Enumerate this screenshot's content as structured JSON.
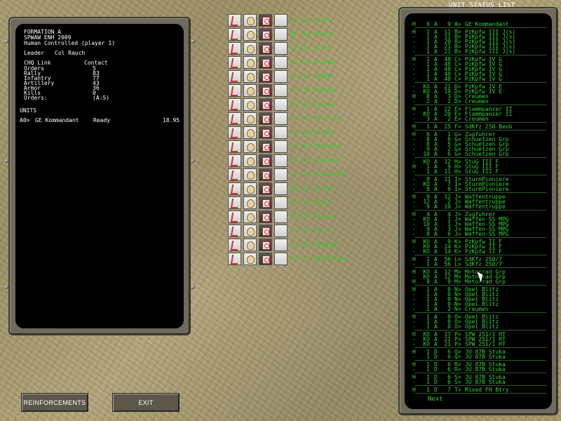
{
  "formation": {
    "title": "FORMATION A",
    "scenario": "SPWAW ENH 2009",
    "control": "Human Controlled (player 1)",
    "leader_label": "Leader",
    "leader_value": "Col Rauch",
    "stats_header": [
      "CHQ Link",
      "Contact"
    ],
    "stats": [
      {
        "label": "Orders",
        "value": "5"
      },
      {
        "label": "Rally",
        "value": "83"
      },
      {
        "label": "Infantry",
        "value": "77"
      },
      {
        "label": "Artillery",
        "value": "43"
      },
      {
        "label": "Armor",
        "value": "36"
      },
      {
        "label": "Kills",
        "value": "0"
      },
      {
        "label": "Orders:",
        "value": "(A:5)"
      }
    ],
    "units_label": "UNITS",
    "units": [
      {
        "id": "A0>",
        "name": "GE Kommandant",
        "status": "Ready",
        "value": "18.95"
      }
    ]
  },
  "formation_leaders": [
    "A> Col Rauch",
    "B> 1Lt Brandt",
    "C> 1Lt Wirth",
    "D> 1Lt Stiegel",
    "E> 1Lt Vebber",
    "F> 1Lt Steiner",
    "G> 1Lt Krause",
    "H> 2Lt Heidrich",
    "I> Sgt Krogel",
    "J> 2Lt Albrecht",
    "K> 2Lt Schirmer",
    "L> 1Lt Schmeltzer",
    "M> 1Lt Teiner",
    "N> 1Lt Meyer",
    "O> 1Lt Brunner",
    "P> 1Lt Wirth",
    "Q> 1Lt Baumann",
    "R> 1Lt Rittenhaus"
  ],
  "unit_status": {
    "title": "UNIT STATUS LIST",
    "groups": [
      [
        [
          "H",
          "6",
          "A",
          "9",
          "A>",
          "GE Kommandant"
        ]
      ],
      [
        [
          "H",
          "1",
          "A",
          "11",
          "B>",
          "PzKpfw III J(s)"
        ],
        [
          "-",
          "1",
          "A",
          "11",
          "B>",
          "PzKpfw III J(s)"
        ],
        [
          "-",
          "1",
          "A",
          "20",
          "B>",
          "PzKpfw III J(s)"
        ],
        [
          "-",
          "1",
          "A",
          "21",
          "B>",
          "PzKpfw III J(s)"
        ],
        [
          "-",
          "1",
          "A",
          "21",
          "B>",
          "PzKpfw III J(s)"
        ]
      ],
      [
        [
          "H",
          "1",
          "A",
          "48",
          "C>",
          "PzKpfw IV G"
        ],
        [
          "-",
          "1",
          "A",
          "48",
          "C>",
          "PzKpfw IV G"
        ],
        [
          "-",
          "1",
          "A",
          "48",
          "C>",
          "PzKpfw IV G"
        ],
        [
          "-",
          "1",
          "A",
          "48",
          "C>",
          "PzKpfw IV G"
        ],
        [
          "-",
          "1",
          "A",
          "48",
          "C>",
          "PzKpfw IV G"
        ]
      ],
      [
        [
          "-",
          "KO",
          "A",
          "21",
          "D>",
          "PzKpfw IV E"
        ],
        [
          "-",
          "KO",
          "A",
          "19",
          "D>",
          "PzKpfw IV E"
        ],
        [
          "H",
          "8",
          "A",
          "3",
          "D>",
          "Creumen"
        ],
        [
          "-",
          "2",
          "A",
          "2",
          "D>",
          "Creumen"
        ]
      ],
      [
        [
          "H",
          "1",
          "A",
          "22",
          "E>",
          "Flammpanzer II"
        ],
        [
          "-",
          "KO",
          "A",
          "20",
          "E>",
          "Flammpanzer II"
        ],
        [
          "-",
          "3",
          "A",
          "2",
          "E>",
          "Creumen"
        ]
      ],
      [
        [
          "H",
          "1",
          "A",
          "25",
          "F>",
          "SdKfz 250 Beob"
        ]
      ],
      [
        [
          "H",
          "6",
          "A",
          "1",
          "G>",
          "Zugfuhrer"
        ],
        [
          "-",
          "8",
          "A",
          "6",
          "G>",
          "Schuetzen Grp"
        ],
        [
          "-",
          "8",
          "A",
          "5",
          "G>",
          "Schuetzen Grp"
        ],
        [
          "-",
          "9",
          "A",
          "2",
          "G>",
          "Schuetzen Grp"
        ],
        [
          "-",
          "10",
          "A",
          "6",
          "G>",
          "Schuetzen Grp"
        ]
      ],
      [
        [
          "-",
          "KO",
          "A",
          "12",
          "H>",
          "StuG III F"
        ],
        [
          "H",
          "1",
          "A",
          "9",
          "H>",
          "StuG III F"
        ],
        [
          "-",
          "1",
          "A",
          "11",
          "H>",
          "StuG III F"
        ]
      ],
      [
        [
          "-",
          "8",
          "A",
          "11",
          "I>",
          "SturmPioniere"
        ],
        [
          "-",
          "KO",
          "A",
          "7",
          "I>",
          "SturmPioniere"
        ],
        [
          "-",
          "8",
          "A",
          "6",
          "I>",
          "SturmPioniere"
        ]
      ],
      [
        [
          "H",
          "9",
          "A",
          "12",
          "J>",
          "Waffentruppe"
        ],
        [
          "-",
          "12",
          "A",
          "2",
          "J>",
          "Waffentruppe"
        ],
        [
          "-",
          "9",
          "A",
          "10",
          "J>",
          "Waffentruppe"
        ]
      ],
      [
        [
          "H",
          "4",
          "A",
          "4",
          "J>",
          "Zugfuhrer"
        ],
        [
          "-",
          "KO",
          "A",
          "1",
          "J>",
          "Waffen-SS MPG"
        ],
        [
          "-",
          "10",
          "A",
          "1",
          "J>",
          "Waffen-SS MPG"
        ],
        [
          "-",
          "9",
          "A",
          "3",
          "J>",
          "Waffen-SS MPG"
        ],
        [
          "-",
          "8",
          "A",
          "6",
          "J>",
          "Waffen-SS MPG"
        ]
      ],
      [
        [
          "H",
          "KO",
          "A",
          "9",
          "K>",
          "PzKpfw II F"
        ],
        [
          "-",
          "KO",
          "A",
          "14",
          "K>",
          "PzKpfw II F"
        ],
        [
          "-",
          "KO",
          "A",
          "14",
          "K>",
          "PzKpfw II F"
        ]
      ],
      [
        [
          "H",
          "1",
          "A",
          "56",
          "L>",
          "SdKfz 250/7"
        ],
        [
          "-",
          "1",
          "A",
          "56",
          "L>",
          "SdKfz 250/7"
        ]
      ],
      [
        [
          "H",
          "KO",
          "A",
          "12",
          "M>",
          "Motorrad Grp"
        ],
        [
          "-",
          "KO",
          "A",
          "12",
          "M>",
          "Motorrad Grp"
        ],
        [
          "H",
          "8",
          "A",
          "9",
          "M>",
          "Motorrad Grp"
        ]
      ],
      [
        [
          "H",
          "1",
          "A",
          "0",
          "N>",
          "Opel Blitz"
        ],
        [
          "-",
          "1",
          "A",
          "0",
          "N>",
          "Opel Blitz"
        ],
        [
          "-",
          "1",
          "A",
          "0",
          "N>",
          "Opel Blitz"
        ],
        [
          "-",
          "1",
          "A",
          "0",
          "N>",
          "Opel Blitz"
        ],
        [
          "-",
          "1",
          "A",
          "2",
          "N>",
          "Creumen"
        ]
      ],
      [
        [
          "H",
          "1",
          "A",
          "0",
          "O>",
          "Opel Blitz"
        ],
        [
          "-",
          "1",
          "A",
          "0",
          "O>",
          "Opel Blitz"
        ],
        [
          "-",
          "1",
          "A",
          "0",
          "O>",
          "Opel Blitz"
        ]
      ],
      [
        [
          "H",
          "KO",
          "A",
          "17",
          "P>",
          "SPW 251/1 HT"
        ],
        [
          "-",
          "KO",
          "A",
          "21",
          "P>",
          "SPW 251/1 HT"
        ],
        [
          "-",
          "KO",
          "A",
          "21",
          "P>",
          "SPW 251/1 HT"
        ]
      ],
      [
        [
          "H",
          "1",
          "D",
          "6",
          "Q>",
          "JU 87B Stuka"
        ],
        [
          "-",
          "1",
          "D",
          "6",
          "Q>",
          "JU 87B Stuka"
        ]
      ],
      [
        [
          "H",
          "1",
          "D",
          "6",
          "R>",
          "JU 87B Stuka"
        ],
        [
          "-",
          "1",
          "D",
          "6",
          "R>",
          "JU 87B Stuka"
        ]
      ],
      [
        [
          "H",
          "1",
          "D",
          "6",
          "S>",
          "JU 87B Stuka"
        ],
        [
          "-",
          "1",
          "D",
          "6",
          "S>",
          "JU 87B Stuka"
        ]
      ],
      [
        [
          "H",
          "1",
          "D",
          "7",
          "T>",
          "Mixed FH Btry"
        ]
      ]
    ],
    "next_label": "Next"
  },
  "buttons": {
    "reinforcements": "REINFORCEMENTS",
    "exit": "EXIT"
  }
}
